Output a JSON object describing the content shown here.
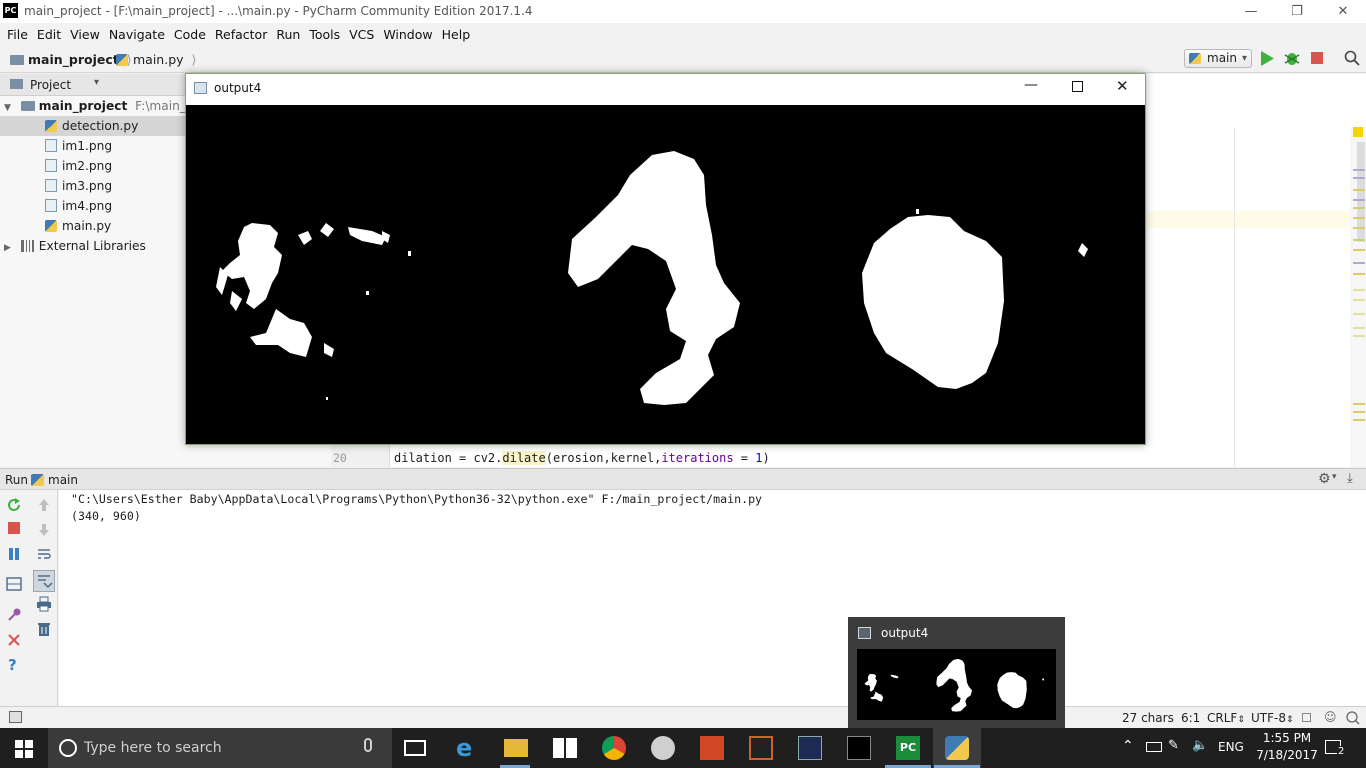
{
  "window": {
    "title": "main_project - [F:\\main_project] - ...\\main.py - PyCharm Community Edition 2017.1.4",
    "app_icon": "PC"
  },
  "menu": [
    "File",
    "Edit",
    "View",
    "Navigate",
    "Code",
    "Refactor",
    "Run",
    "Tools",
    "VCS",
    "Window",
    "Help"
  ],
  "nav": {
    "project": "main_project",
    "file": "main.py",
    "run_config": "main"
  },
  "project_panel": {
    "header": "Project",
    "root_name": "main_project",
    "root_path": "F:\\main_proj",
    "files": [
      "detection.py",
      "im1.png",
      "im2.png",
      "im3.png",
      "im4.png",
      "main.py"
    ],
    "external": "External Libraries"
  },
  "editor": {
    "line_number": "20",
    "code": {
      "part1": "dilation = cv2.",
      "fn": "dilate",
      "part2": "(erosion,kernel,",
      "kw": "iterations",
      "part3": " = ",
      "num": "1",
      "part4": ")"
    }
  },
  "run_panel": {
    "label": "Run",
    "config": "main",
    "lines": [
      "\"C:\\Users\\Esther Baby\\AppData\\Local\\Programs\\Python\\Python36-32\\python.exe\" F:/main_project/main.py",
      "(340, 960)"
    ]
  },
  "status": {
    "chars": "27 chars",
    "position": "6:1",
    "line_sep": "CRLF",
    "encoding": "UTF-8"
  },
  "taskbar": {
    "search_placeholder": "Type here to search",
    "lang": "ENG",
    "time": "1:55 PM",
    "date": "7/18/2017",
    "notifications": "2"
  },
  "output_window": {
    "title": "output4"
  },
  "thumbnail": {
    "title": "output4"
  },
  "colors": {
    "run_green": "#3fb13f",
    "stop_red": "#d9534f",
    "taskbar": "#1f1f1f",
    "accent_blue": "#3a7fc1"
  }
}
